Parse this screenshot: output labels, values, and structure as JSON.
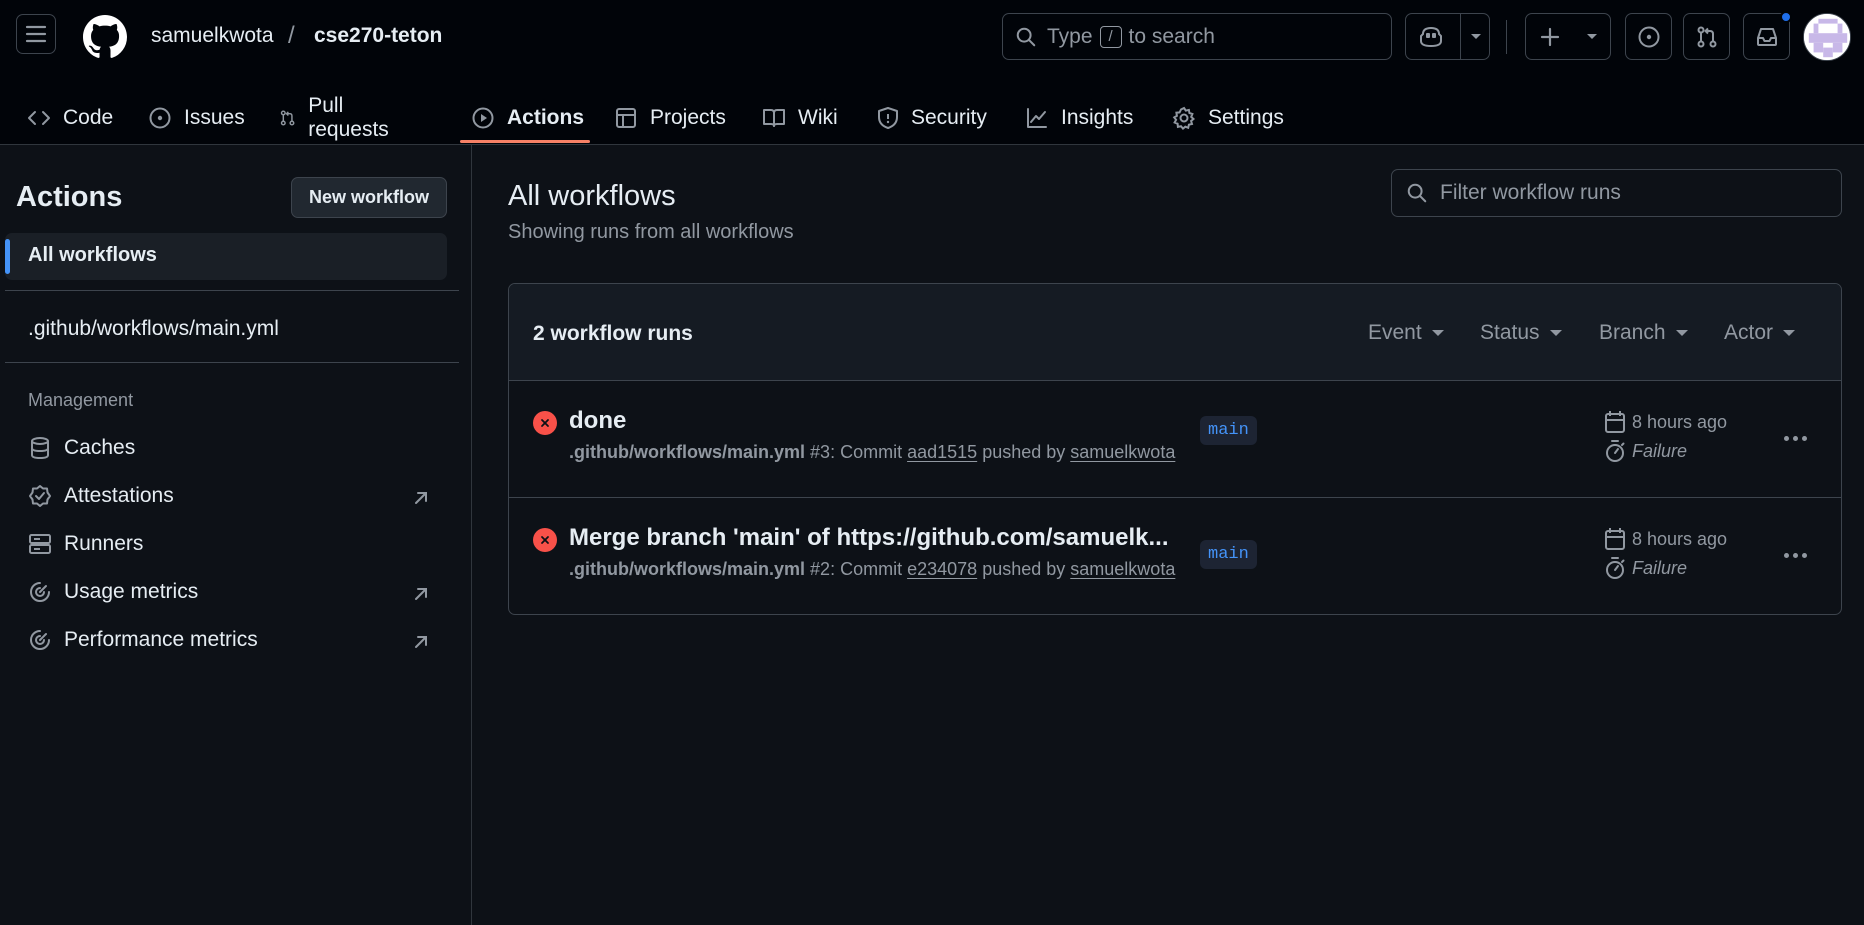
{
  "header": {
    "owner": "samuelkwota",
    "separator": "/",
    "repo": "cse270-teton",
    "search": {
      "prefix": "Type",
      "key": "/",
      "suffix": "to search"
    }
  },
  "repo_nav": {
    "tabs": [
      {
        "label": "Code",
        "icon": "code-icon"
      },
      {
        "label": "Issues",
        "icon": "issue-opened-icon"
      },
      {
        "label": "Pull requests",
        "icon": "git-pull-request-icon"
      },
      {
        "label": "Actions",
        "icon": "play-icon",
        "active": true
      },
      {
        "label": "Projects",
        "icon": "table-icon"
      },
      {
        "label": "Wiki",
        "icon": "book-icon"
      },
      {
        "label": "Security",
        "icon": "shield-icon"
      },
      {
        "label": "Insights",
        "icon": "graph-icon"
      },
      {
        "label": "Settings",
        "icon": "gear-icon"
      }
    ]
  },
  "sidebar": {
    "title": "Actions",
    "new_workflow": "New workflow",
    "all_workflows": "All workflows",
    "workflow_file": ".github/workflows/main.yml",
    "management_label": "Management",
    "management": [
      {
        "label": "Caches",
        "icon": "database-icon",
        "external": false
      },
      {
        "label": "Attestations",
        "icon": "verified-icon",
        "external": true
      },
      {
        "label": "Runners",
        "icon": "server-icon",
        "external": false
      },
      {
        "label": "Usage metrics",
        "icon": "meter-icon",
        "external": true
      },
      {
        "label": "Performance metrics",
        "icon": "meter-icon",
        "external": true
      }
    ]
  },
  "main": {
    "title": "All workflows",
    "subtitle": "Showing runs from all workflows",
    "filter_placeholder": "Filter workflow runs",
    "runs_count": "2 workflow runs",
    "filters": [
      "Event",
      "Status",
      "Branch",
      "Actor"
    ],
    "runs": [
      {
        "title": "done",
        "workflow": ".github/workflows/main.yml",
        "run_number": "#3",
        "commit_prefix": ": Commit",
        "commit": "aad1515",
        "pushed_by": "pushed by",
        "author": "samuelkwota",
        "branch": "main",
        "when": "8 hours ago",
        "status": "Failure"
      },
      {
        "title": "Merge branch 'main' of https://github.com/samuelk...",
        "workflow": ".github/workflows/main.yml",
        "run_number": "#2",
        "commit_prefix": ": Commit",
        "commit": "e234078",
        "pushed_by": "pushed by",
        "author": "samuelkwota",
        "branch": "main",
        "when": "8 hours ago",
        "status": "Failure"
      }
    ]
  },
  "colors": {
    "background": "#0d1117",
    "header_background": "#010409",
    "accent": "#4493f8",
    "active_tab_underline": "#f78166",
    "failure": "#f85149"
  }
}
